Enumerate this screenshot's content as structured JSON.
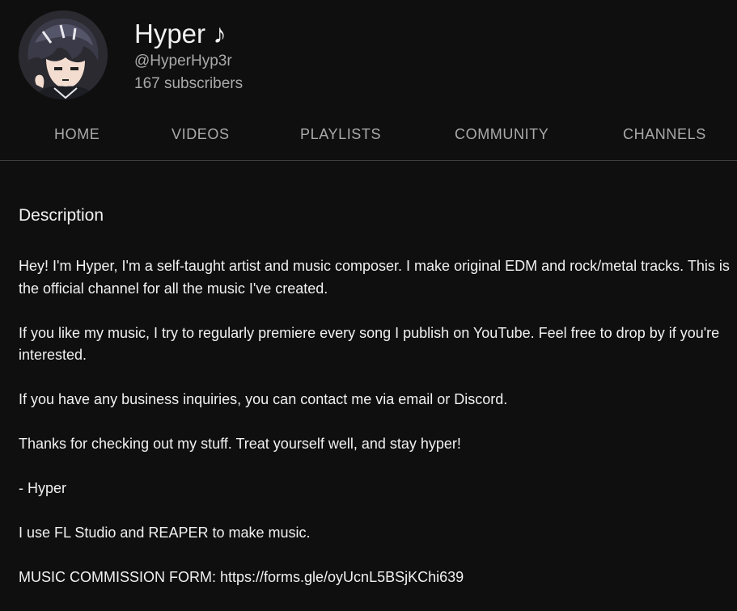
{
  "channel": {
    "name": "Hyper ♪",
    "handle": "@HyperHyp3r",
    "subscribers": "167 subscribers",
    "avatar_icon": "anime-character-avatar-icon"
  },
  "tabs": [
    {
      "label": "HOME"
    },
    {
      "label": "VIDEOS"
    },
    {
      "label": "PLAYLISTS"
    },
    {
      "label": "COMMUNITY"
    },
    {
      "label": "CHANNELS"
    }
  ],
  "about": {
    "title": "Description",
    "paragraphs": [
      "Hey! I'm Hyper, I'm a self-taught artist and music composer. I make original EDM and rock/metal tracks. This is the official channel for all the music I've created.",
      "If you like my music, I try to regularly premiere every song I publish on YouTube. Feel free to drop by if you're interested.",
      "If you have any business inquiries, you can contact me via email or Discord.",
      "Thanks for checking out my stuff. Treat yourself well, and stay hyper!",
      "- Hyper",
      "I use FL Studio and REAPER to make music.",
      "MUSIC COMMISSION FORM: https://forms.gle/oyUcnL5BSjKChi639"
    ]
  },
  "colors": {
    "background": "#0f0f0f",
    "text_primary": "#f1f1f1",
    "text_secondary": "#aaaaaa",
    "divider": "#3f3f3f"
  }
}
